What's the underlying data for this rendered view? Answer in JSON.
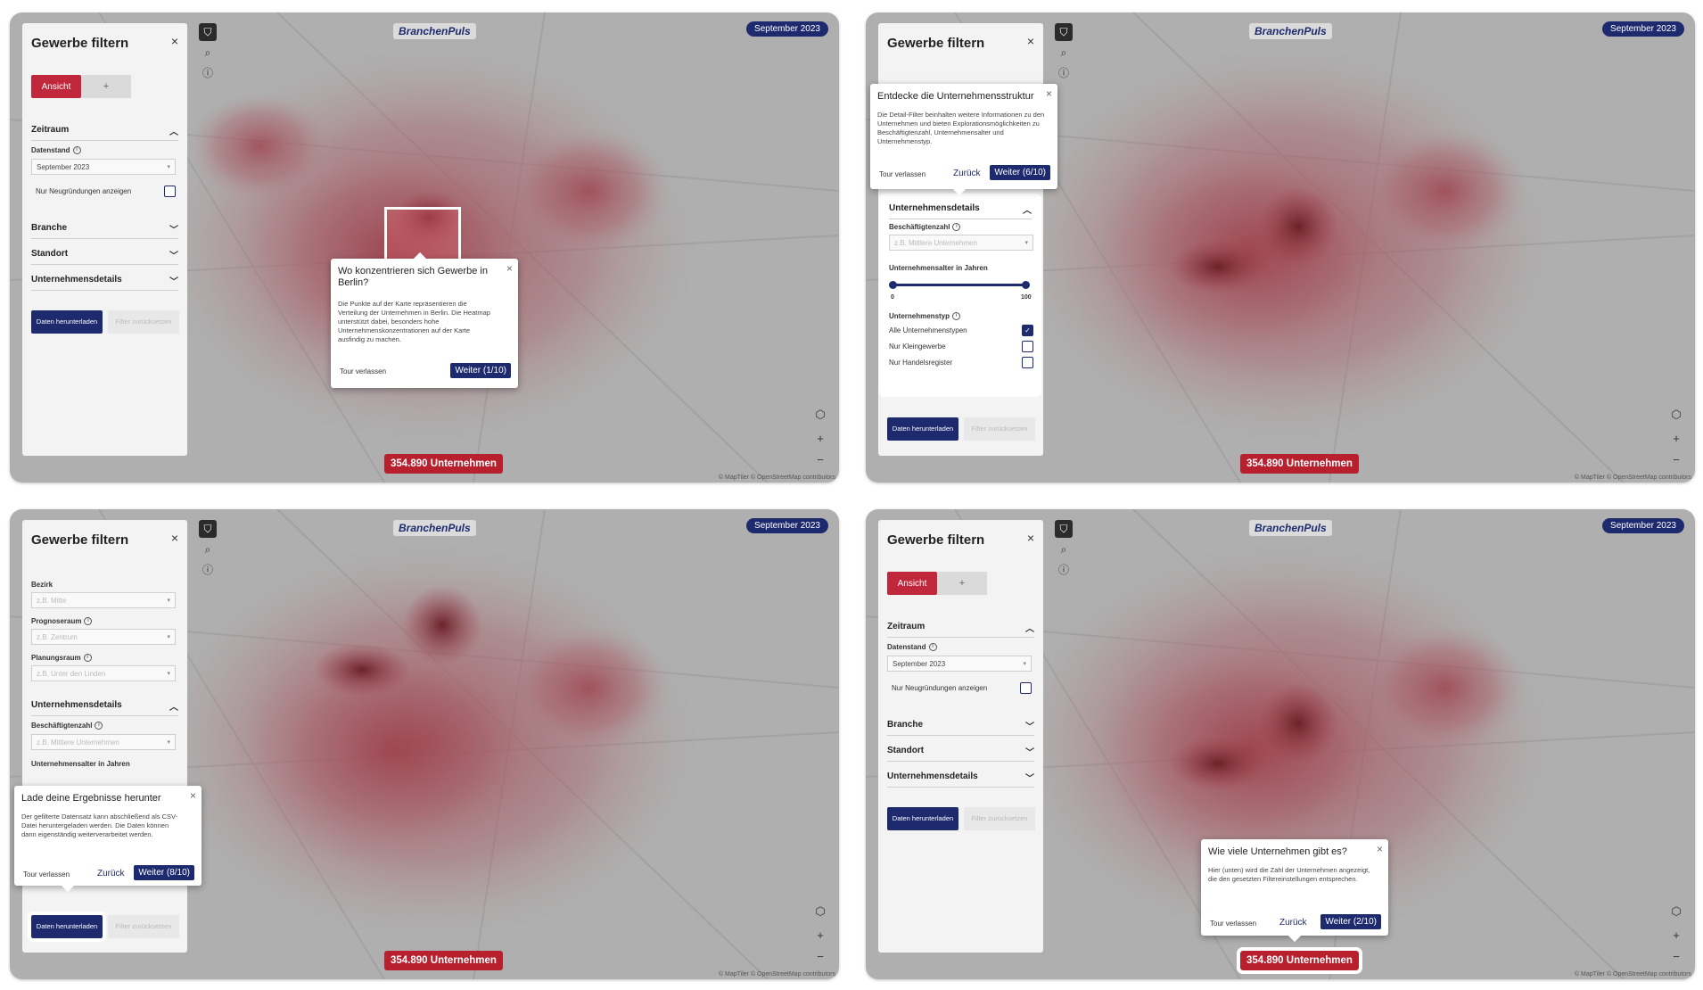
{
  "app": {
    "brand": "BranchenPuls",
    "date_pill": "September 2023",
    "count": "354.890 Unternehmen",
    "attribution": "© MapTiler © OpenStreetMap contributors"
  },
  "sidebar": {
    "title": "Gewerbe filtern",
    "tab_view": "Ansicht",
    "tab_add": "+",
    "section_time": "Zeitraum",
    "label_datenstand": "Datenstand",
    "datenstand_value": "September 2023",
    "only_new": "Nur Neugründungen anzeigen",
    "section_branche": "Branche",
    "section_standort": "Standort",
    "section_details": "Unternehmensdetails",
    "btn_download": "Daten herunterladen",
    "btn_reset": "Filter zurücksetzen",
    "label_bezirk": "Bezirk",
    "ph_bezirk": "z.B. Mitte",
    "label_prognoseraum": "Prognoseraum",
    "ph_prognoseraum": "z.B. Zentrum",
    "label_planungsraum": "Planungsraum",
    "ph_planungsraum": "z.B. Unter den Linden",
    "label_beschaeftigte": "Beschäftigtenzahl",
    "ph_beschaeftigte": "z.B. Mittlere Unternehmen",
    "label_alter": "Unternehmensalter in Jahren",
    "alter_min": "0",
    "alter_max": "100",
    "label_typ": "Unternehmenstyp",
    "typ_all": "Alle Unternehmenstypen",
    "typ_klein": "Nur Kleingewerbe",
    "typ_hr": "Nur Handelsregister"
  },
  "tour": {
    "exit": "Tour verlassen",
    "back": "Zurück",
    "step1": {
      "title": "Wo konzentrieren sich Gewerbe in Berlin?",
      "body": "Die Punkte auf der Karte repräsentieren die Verteilung der Unternehmen in Berlin. Die Heatmap unterstützt dabei, besonders hohe Unternehmenskonzentrationen auf der Karte ausfindig zu machen.",
      "next": "Weiter (1/10)"
    },
    "step6": {
      "title": "Entdecke die Unternehmensstruktur",
      "body": "Die Detail-Filter beinhalten weitere Informationen zu den Unternehmen und bieten Explorationsmöglichkeiten zu Beschäftigtenzahl, Unternehmensalter und Unternehmenstyp.",
      "next": "Weiter (6/10)"
    },
    "step8": {
      "title": "Lade deine Ergebnisse herunter",
      "body": "Der gefilterte Datensatz kann abschließend als CSV-Datei heruntergeladen werden. Die Daten können dann eigenständig weiterverarbeitet werden.",
      "next": "Weiter (8/10)"
    },
    "step2": {
      "title": "Wie viele Unternehmen gibt es?",
      "body": "Hier (unten) wird die Zahl der Unternehmen angezeigt, die den gesetzten Filtereinstellungen entsprechen.",
      "next": "Weiter (2/10)"
    }
  },
  "icons": {
    "filter": "filter-icon",
    "search": "search-icon",
    "info": "info-icon",
    "cube": "3d-cube-icon",
    "zoom_in": "zoom-in-icon",
    "zoom_out": "zoom-out-icon",
    "close": "close-icon",
    "chevron": "chevron-icon"
  },
  "colors": {
    "navy": "#1e2a6e",
    "red": "#c0273a",
    "heat": "#c8384a"
  }
}
